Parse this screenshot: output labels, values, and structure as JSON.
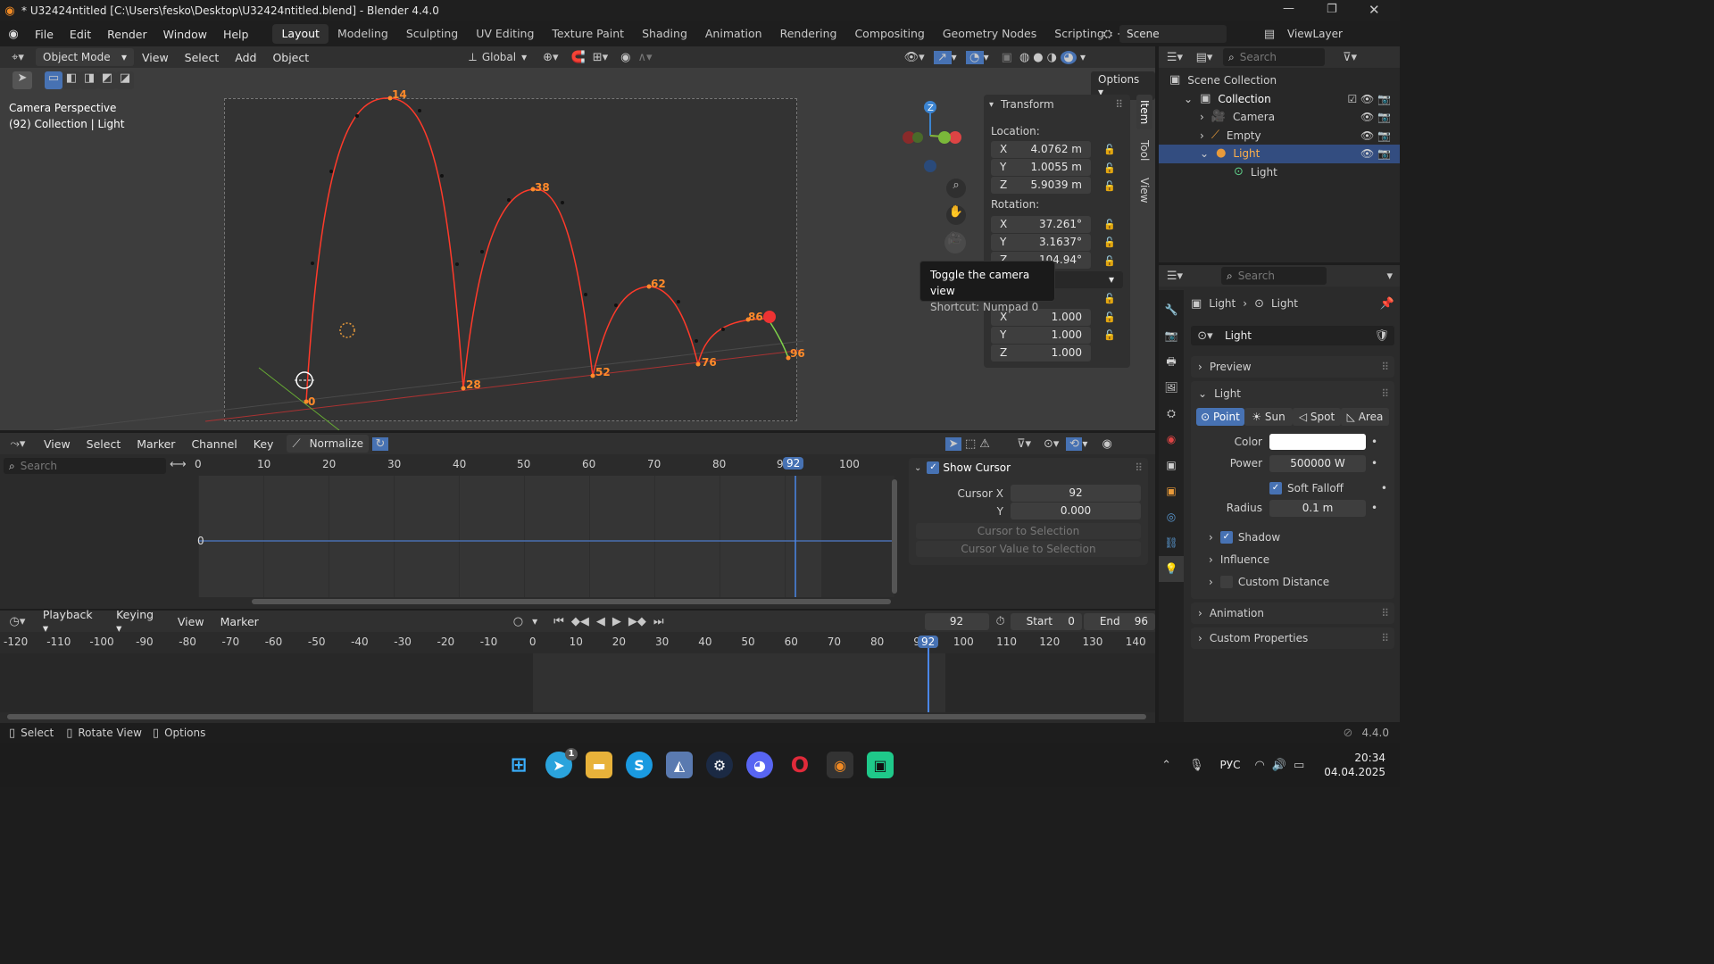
{
  "title": "* U32424ntitled [C:\\Users\\fesko\\Desktop\\U32424ntitled.blend] - Blender 4.4.0",
  "menu": [
    "File",
    "Edit",
    "Render",
    "Window",
    "Help"
  ],
  "workspaces": [
    "Layout",
    "Modeling",
    "Sculpting",
    "UV Editing",
    "Texture Paint",
    "Shading",
    "Animation",
    "Rendering",
    "Compositing",
    "Geometry Nodes",
    "Scripting"
  ],
  "scene": "Scene",
  "viewlayer": "ViewLayer",
  "viewport": {
    "mode": "Object Mode",
    "menus": [
      "View",
      "Select",
      "Add",
      "Object"
    ],
    "orientation": "Global",
    "options": "Options",
    "info1": "Camera Perspective",
    "info2": "(92) Collection | Light",
    "frames": [
      "14",
      "38",
      "62",
      "86",
      "96",
      "0",
      "28",
      "52",
      "76"
    ],
    "tooltip_title": "Toggle the camera view",
    "tooltip_shortcut": "Shortcut: Numpad 0",
    "side_tabs": [
      "Item",
      "Tool",
      "View"
    ]
  },
  "transform": {
    "title": "Transform",
    "location": "Location:",
    "lx": "4.0762 m",
    "ly": "1.0055 m",
    "lz": "5.9039 m",
    "rotation": "Rotation:",
    "rx": "37.261°",
    "ry": "3.1637°",
    "rz": "104.94°",
    "sx": "1.000",
    "sy": "1.000",
    "sz": "1.000",
    "X": "X",
    "Y": "Y",
    "Z": "Z"
  },
  "outliner": {
    "search": "Search",
    "scene_collection": "Scene Collection",
    "collection": "Collection",
    "items": [
      "Camera",
      "Empty",
      "Light",
      "Light"
    ]
  },
  "properties": {
    "search": "Search",
    "crumb1": "Light",
    "crumb2": "Light",
    "datablock": "Light",
    "preview": "Preview",
    "light": "Light",
    "types": [
      "Point",
      "Sun",
      "Spot",
      "Area"
    ],
    "color": "Color",
    "power": "Power",
    "power_val": "500000 W",
    "soft_falloff": "Soft Falloff",
    "radius": "Radius",
    "radius_val": "0.1 m",
    "shadow": "Shadow",
    "influence": "Influence",
    "custom_distance": "Custom Distance",
    "animation": "Animation",
    "custom_props": "Custom Properties"
  },
  "graph": {
    "menus": [
      "View",
      "Select",
      "Marker",
      "Channel",
      "Key"
    ],
    "normalize": "Normalize",
    "search": "Search",
    "ticks": [
      "0",
      "10",
      "20",
      "30",
      "40",
      "50",
      "60",
      "70",
      "80",
      "90",
      "100"
    ],
    "current": "92",
    "zero": "0",
    "show_cursor": "Show Cursor",
    "cursor_x": "Cursor X",
    "cursor_x_val": "92",
    "cursor_y": "Y",
    "cursor_y_val": "0.000",
    "to_sel": "Cursor to Selection",
    "val_to_sel": "Cursor Value to Selection"
  },
  "timeline": {
    "menus": [
      "Playback",
      "Keying",
      "View",
      "Marker"
    ],
    "frame": "92",
    "start_lbl": "Start",
    "start": "0",
    "end_lbl": "End",
    "end": "96",
    "ticks": [
      "-120",
      "-110",
      "-100",
      "-90",
      "-80",
      "-70",
      "-60",
      "-50",
      "-40",
      "-30",
      "-20",
      "-10",
      "0",
      "10",
      "20",
      "30",
      "40",
      "50",
      "60",
      "70",
      "80",
      "90",
      "100",
      "110",
      "120",
      "130",
      "140"
    ]
  },
  "status": {
    "select": "Select",
    "rotate": "Rotate View",
    "options": "Options",
    "version": "4.4.0"
  },
  "taskbar": {
    "lang": "РУС",
    "time": "20:34",
    "date": "04.04.2025",
    "badge": "1"
  }
}
